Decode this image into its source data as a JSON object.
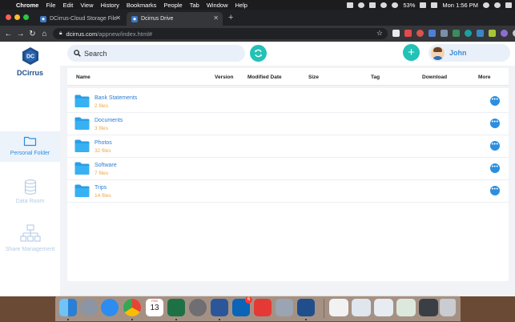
{
  "menubar": {
    "items": [
      "Chrome",
      "File",
      "Edit",
      "View",
      "History",
      "Bookmarks",
      "People",
      "Tab",
      "Window",
      "Help"
    ],
    "battery": "53%",
    "clock": "Mon 1:56 PM"
  },
  "browser": {
    "tabs": [
      {
        "title": "DCirrus-Cloud Storage File"
      },
      {
        "title": "Dcirrus Drive"
      }
    ],
    "url_domain": "dcirrus.com",
    "url_path": "/appnew/index.html#"
  },
  "sidebar": {
    "brand": "DCirrus",
    "items": [
      {
        "label": "Personal Folder",
        "icon": "folder-icon",
        "active": true
      },
      {
        "label": "Data Room",
        "icon": "database-icon",
        "active": false
      },
      {
        "label": "Share Management",
        "icon": "sitemap-icon",
        "active": false
      }
    ]
  },
  "topbar": {
    "search_placeholder": "Search",
    "user_name": "John"
  },
  "table": {
    "columns": [
      "Name",
      "Version",
      "Modified Date",
      "Size",
      "Tag",
      "Download",
      "More"
    ],
    "rows": [
      {
        "name": "Bank Statements",
        "count": "2 files"
      },
      {
        "name": "Documents",
        "count": "3 files"
      },
      {
        "name": "Photos",
        "count": "32 files"
      },
      {
        "name": "Software",
        "count": "7 files"
      },
      {
        "name": "Trips",
        "count": "14 files"
      }
    ]
  },
  "dock": {
    "calendar_day": "13",
    "calendar_month": "FEB",
    "mail_badge": "6"
  },
  "colors": {
    "accent": "#22c2b6",
    "brand_blue": "#1f4e8c",
    "link_blue": "#2d7dd2",
    "count_orange": "#f0a640"
  }
}
